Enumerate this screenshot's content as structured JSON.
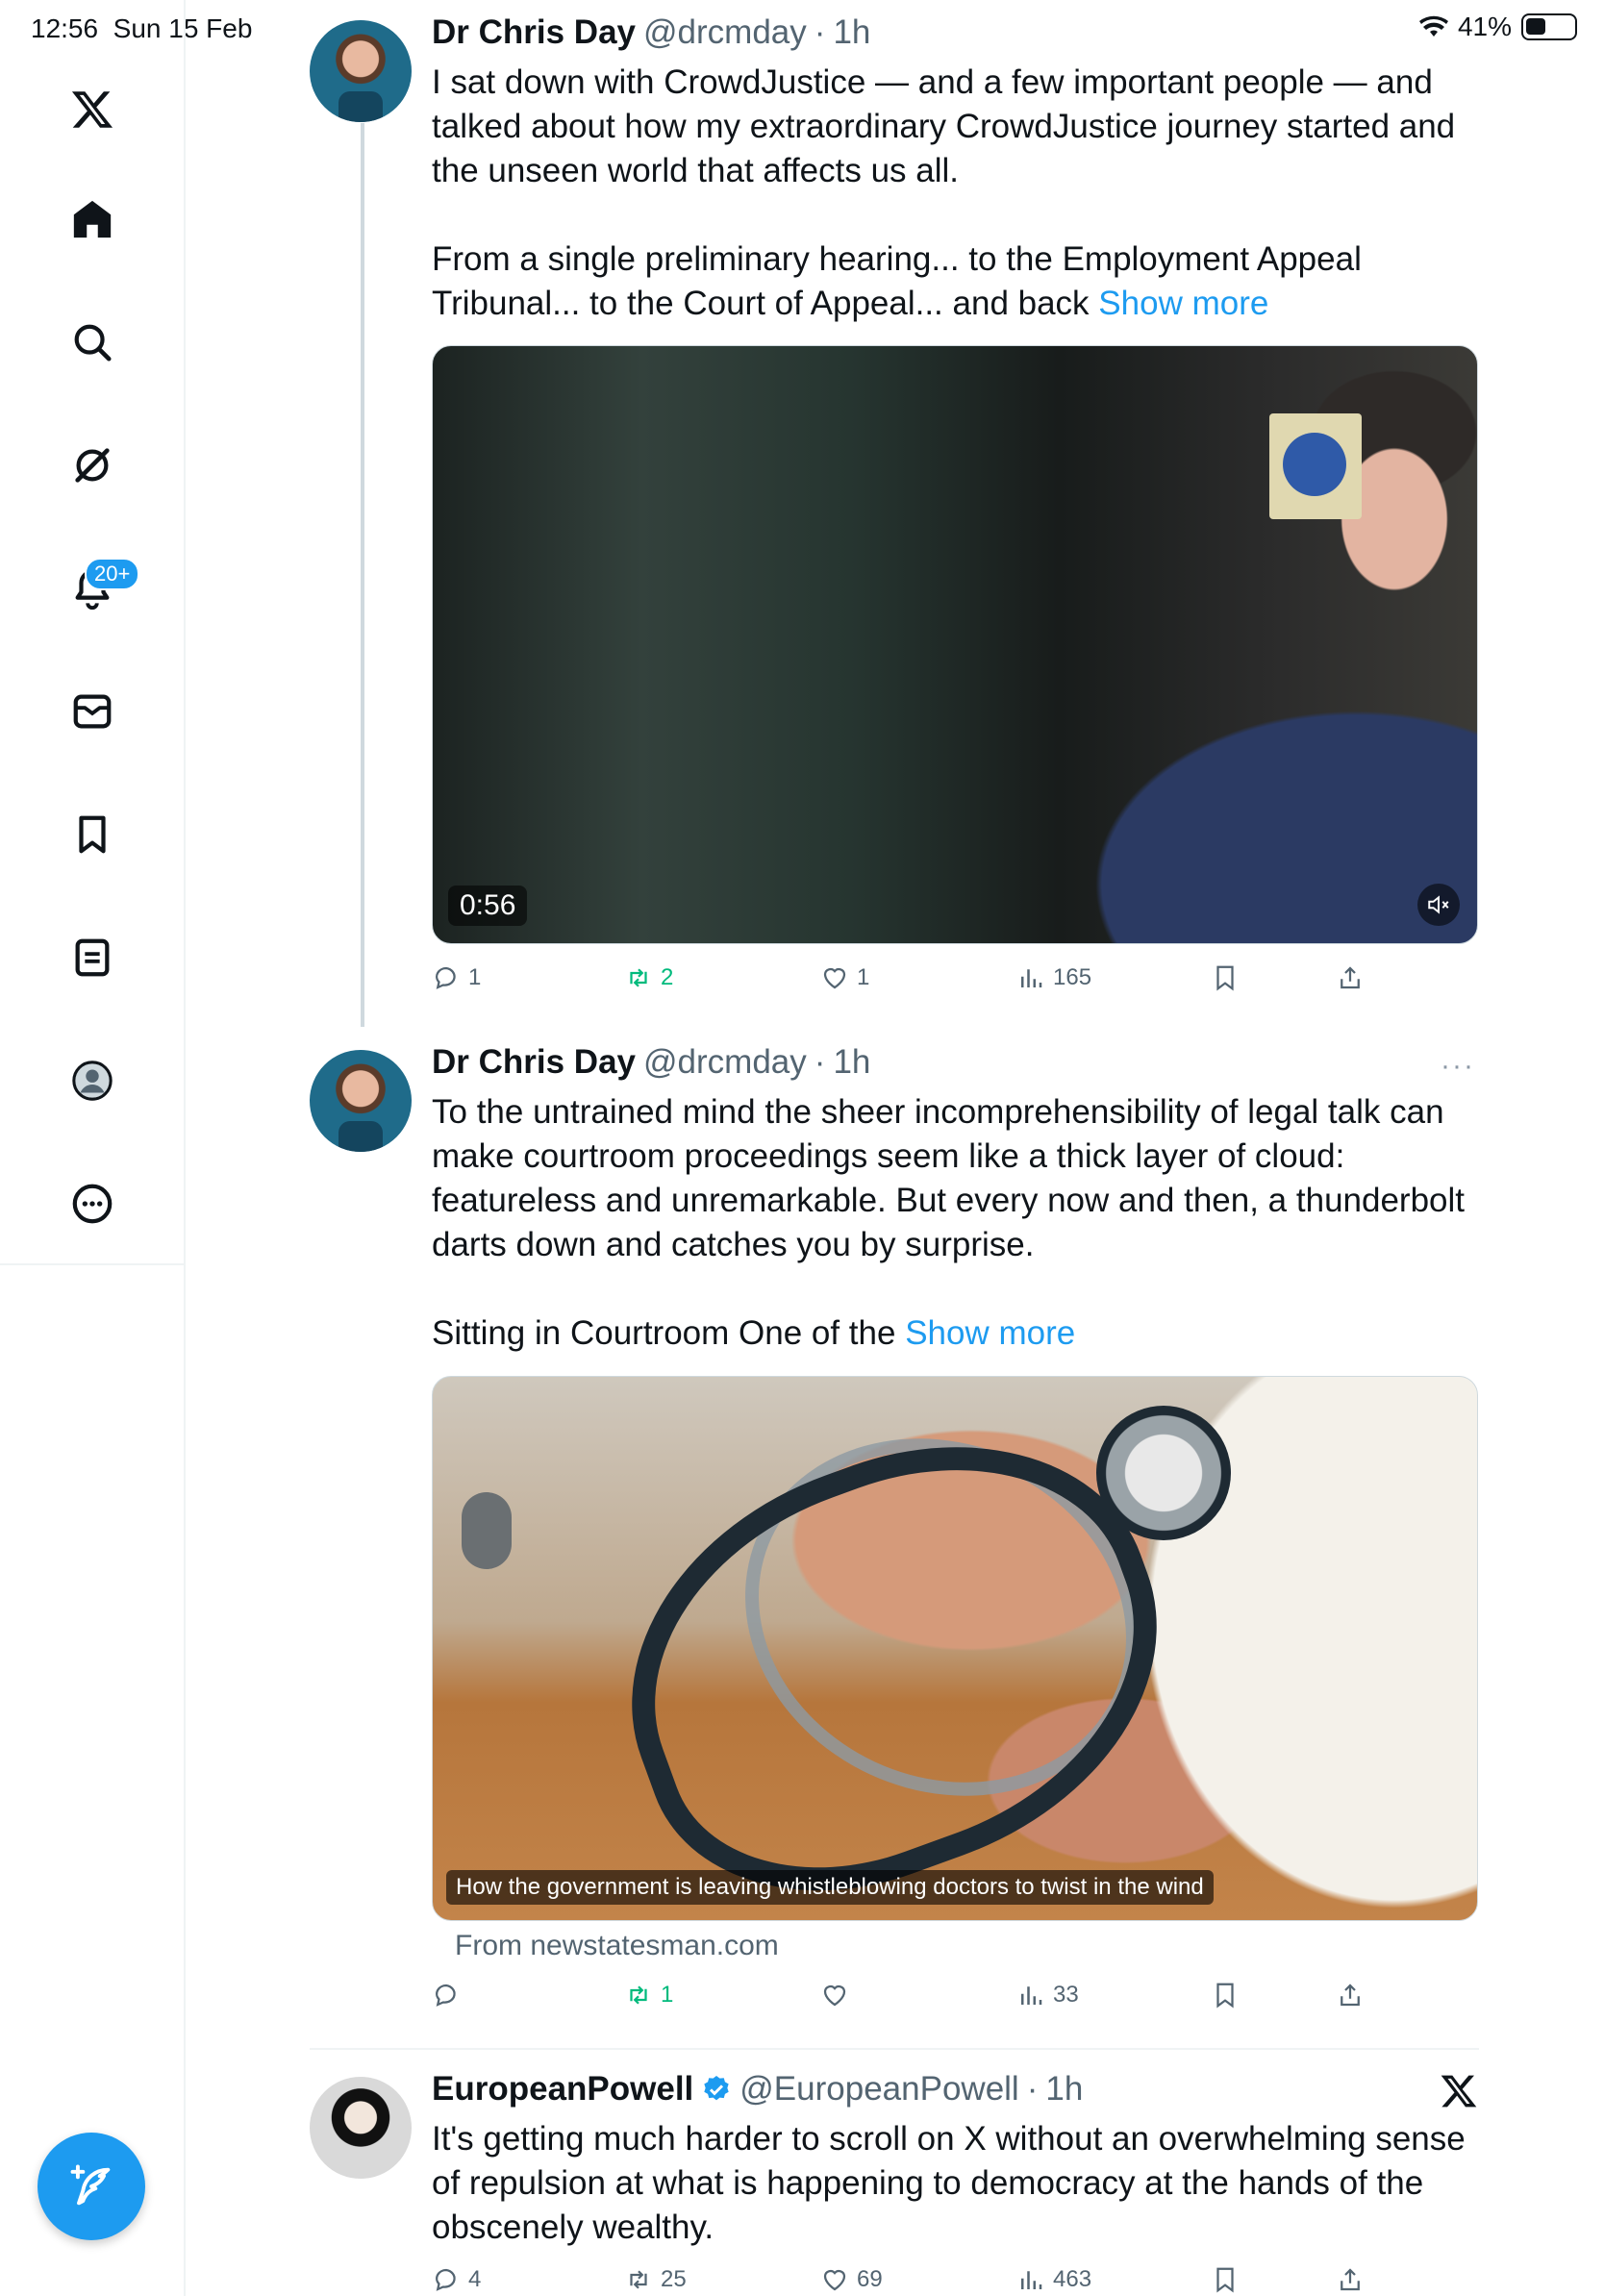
{
  "status_bar": {
    "time": "12:56",
    "date": "Sun 15 Feb",
    "battery": "41%"
  },
  "sidebar": {
    "items": [
      {
        "name": "x-logo",
        "icon": "x-logo-icon"
      },
      {
        "name": "home",
        "icon": "home-icon"
      },
      {
        "name": "search",
        "icon": "search-icon"
      },
      {
        "name": "grok",
        "icon": "grok-icon"
      },
      {
        "name": "notifications",
        "icon": "bell-icon",
        "badge": "20+"
      },
      {
        "name": "messages",
        "icon": "mail-icon"
      },
      {
        "name": "bookmarks",
        "icon": "bookmark-icon"
      },
      {
        "name": "lists",
        "icon": "list-icon"
      },
      {
        "name": "profile",
        "icon": "avatar-icon"
      },
      {
        "name": "more",
        "icon": "more-icon"
      }
    ],
    "notifications_badge": "20+"
  },
  "tweets": [
    {
      "name": "Dr Chris Day",
      "handle": "@drcmday",
      "sep": "·",
      "time": "1h",
      "text_lines": [
        "I sat down with CrowdJustice — and a few important people — and",
        "talked about how my extraordinary CrowdJustice journey started and",
        "the unseen world that affects us all."
      ],
      "text_para2_line1": "From a single preliminary hearing... to the Employment Appeal",
      "text_para2_line2": "Tribunal... to the Court of Appeal... and back ",
      "show_more": "Show more",
      "video_duration": "0:56",
      "stats": {
        "replies": "1",
        "reposts": "2",
        "likes": "1",
        "views": "165"
      }
    },
    {
      "name": "Dr Chris Day",
      "handle": "@drcmday",
      "sep": "·",
      "time": "1h",
      "text_lines": [
        "To the untrained mind the sheer incomprehensibility of legal talk can",
        "make courtroom proceedings seem like a thick layer of cloud:",
        "featureless and unremarkable. But every now and then, a thunderbolt",
        "darts down and catches you by surprise."
      ],
      "text_para2_line1": "Sitting in Courtroom One of the ",
      "show_more": "Show more",
      "link_caption": "How the government is leaving whistleblowing doctors to twist in the wind",
      "link_source": "From newstatesman.com",
      "more_menu": "···",
      "stats": {
        "replies": "",
        "reposts": "1",
        "likes": "",
        "views": "33"
      }
    },
    {
      "name": "EuropeanPowell",
      "handle": "@EuropeanPowell",
      "sep": "·",
      "time": "1h",
      "verified": true,
      "text_lines": [
        "It's getting much harder to scroll on X without an overwhelming sense",
        "of repulsion at what is happening to democracy at the hands of the",
        "obscenely wealthy."
      ],
      "stats": {
        "replies": "4",
        "reposts": "25",
        "likes": "69",
        "views": "463"
      }
    }
  ],
  "colors": {
    "accent": "#1d9bf0",
    "repost_green": "#00ba7c",
    "muted": "#536471"
  }
}
